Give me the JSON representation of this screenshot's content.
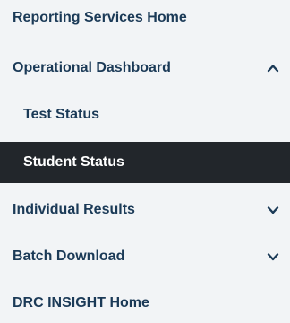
{
  "nav": {
    "items": [
      {
        "label": "Reporting Services Home"
      },
      {
        "label": "Operational Dashboard",
        "icon": "chevron-up-icon"
      },
      {
        "label": "Test Status"
      },
      {
        "label": "Student Status",
        "active": true
      },
      {
        "label": "Individual Results",
        "icon": "chevron-down-icon"
      },
      {
        "label": "Batch Download",
        "icon": "chevron-down-icon"
      },
      {
        "label": "DRC INSIGHT Home"
      }
    ]
  },
  "colors": {
    "text": "#1b3a57",
    "active_background": "#22262b",
    "active_text": "#ffffff",
    "panel_background": "#f2f4f6"
  }
}
